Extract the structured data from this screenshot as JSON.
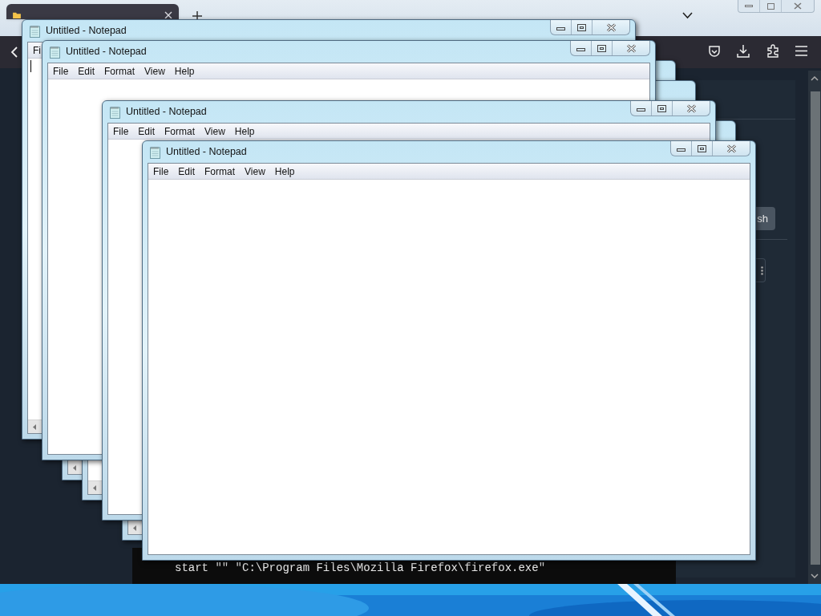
{
  "browser": {
    "tab": {
      "selected": true
    },
    "panel_button": "sh"
  },
  "console": {
    "lines": [
      "start \"\" \"C:\\Program Files\\Mozilla Firefox\\firefox.exe\""
    ]
  },
  "windows": [
    {
      "kind": "notepad",
      "title": "Untitled - Notepad",
      "menu": [
        "Fi"
      ],
      "caret": true,
      "scrollbar": true
    },
    {
      "kind": "notepad",
      "title": "Untitled - Notepad",
      "menu": [
        "File",
        "Edit",
        "Format",
        "View",
        "Help"
      ],
      "caret": false,
      "scrollbar": false
    },
    {
      "kind": "frame",
      "scrollbar": true
    },
    {
      "kind": "frame",
      "scrollbar": true
    },
    {
      "kind": "notepad",
      "title": "Untitled - Notepad",
      "menu": [
        "File",
        "Edit",
        "Format",
        "View",
        "Help"
      ],
      "caret": false,
      "scrollbar": false
    },
    {
      "kind": "frame",
      "scrollbar": true
    },
    {
      "kind": "notepad",
      "title": "Untitled - Notepad",
      "menu": [
        "File",
        "Edit",
        "Format",
        "View",
        "Help"
      ],
      "caret": false,
      "scrollbar": false
    }
  ]
}
